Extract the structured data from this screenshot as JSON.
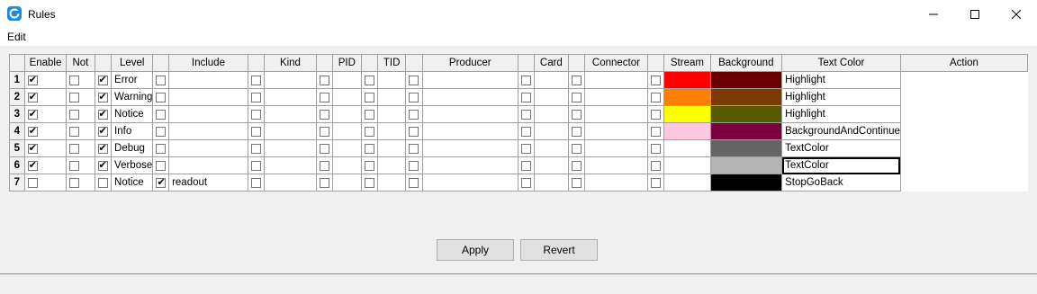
{
  "window": {
    "title": "Rules"
  },
  "menu": {
    "edit": "Edit"
  },
  "columns": [
    "Enable",
    "Not",
    "",
    "Level",
    "",
    "Include",
    "",
    "Kind",
    "",
    "PID",
    "",
    "TID",
    "",
    "Producer",
    "",
    "Card",
    "",
    "Connector",
    "",
    "Stream",
    "Background",
    "Text Color",
    "Action"
  ],
  "rows": [
    {
      "num": "1",
      "enable": true,
      "not": false,
      "lvl_cb": true,
      "level": "Error",
      "inc_cb": false,
      "include": "",
      "bg": "#ff0000",
      "fg": "#6b0000",
      "action": "Highlight"
    },
    {
      "num": "2",
      "enable": true,
      "not": false,
      "lvl_cb": true,
      "level": "Warning",
      "inc_cb": false,
      "include": "",
      "bg": "#ff8000",
      "fg": "#7a3a00",
      "action": "Highlight"
    },
    {
      "num": "3",
      "enable": true,
      "not": false,
      "lvl_cb": true,
      "level": "Notice",
      "inc_cb": false,
      "include": "",
      "bg": "#ffff00",
      "fg": "#5a5a00",
      "action": "Highlight"
    },
    {
      "num": "4",
      "enable": true,
      "not": false,
      "lvl_cb": true,
      "level": "Info",
      "inc_cb": false,
      "include": "",
      "bg": "#ffc8e0",
      "fg": "#7a0040",
      "action": "BackgroundAndContinue"
    },
    {
      "num": "5",
      "enable": true,
      "not": false,
      "lvl_cb": true,
      "level": "Debug",
      "inc_cb": false,
      "include": "",
      "bg": "#ffffff",
      "fg": "#646464",
      "action": "TextColor"
    },
    {
      "num": "6",
      "enable": true,
      "not": false,
      "lvl_cb": true,
      "level": "Verbose",
      "inc_cb": false,
      "include": "",
      "bg": "#ffffff",
      "fg": "#b4b4b4",
      "action": "TextColor"
    },
    {
      "num": "7",
      "enable": false,
      "not": false,
      "lvl_cb": false,
      "level": "Notice",
      "inc_cb": true,
      "include": "readout",
      "bg": "#ffffff",
      "fg": "#000000",
      "action": "StopGoBack"
    }
  ],
  "buttons": {
    "apply": "Apply",
    "revert": "Revert"
  }
}
